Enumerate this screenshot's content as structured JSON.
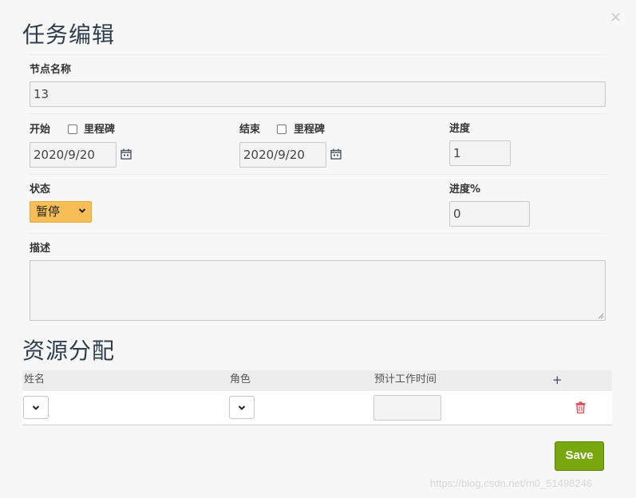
{
  "dialog": {
    "title": "任务编辑",
    "close_glyph": "×"
  },
  "form": {
    "node_name": {
      "label": "节点名称",
      "value": "13"
    },
    "start": {
      "label": "开始",
      "milestone_label": "里程碑",
      "milestone_checked": false,
      "date": "2020/9/20"
    },
    "end": {
      "label": "结束",
      "milestone_label": "里程碑",
      "milestone_checked": false,
      "date": "2020/9/20"
    },
    "duration": {
      "label": "进度",
      "value": "1"
    },
    "status": {
      "label": "状态",
      "value": "暂停"
    },
    "progress": {
      "label": "进度%",
      "value": "0"
    },
    "description": {
      "label": "描述",
      "value": ""
    }
  },
  "resources": {
    "title": "资源分配",
    "columns": [
      "姓名",
      "角色",
      "预计工作时间",
      "+"
    ],
    "rows": [
      {
        "name": "",
        "role": "",
        "effort": ""
      }
    ]
  },
  "footer": {
    "save_label": "Save",
    "watermark": "https://blog.csdn.net/m0_51498246"
  },
  "icons": {
    "calendar": "calendar-icon",
    "delete": "trash-icon",
    "chevron": "chevron-down-icon",
    "close": "close-icon"
  },
  "colors": {
    "status_bg": "#f7be57",
    "save_bg": "#78a80d",
    "delete_icon": "#e0505a",
    "title": "#2f3e4d"
  }
}
